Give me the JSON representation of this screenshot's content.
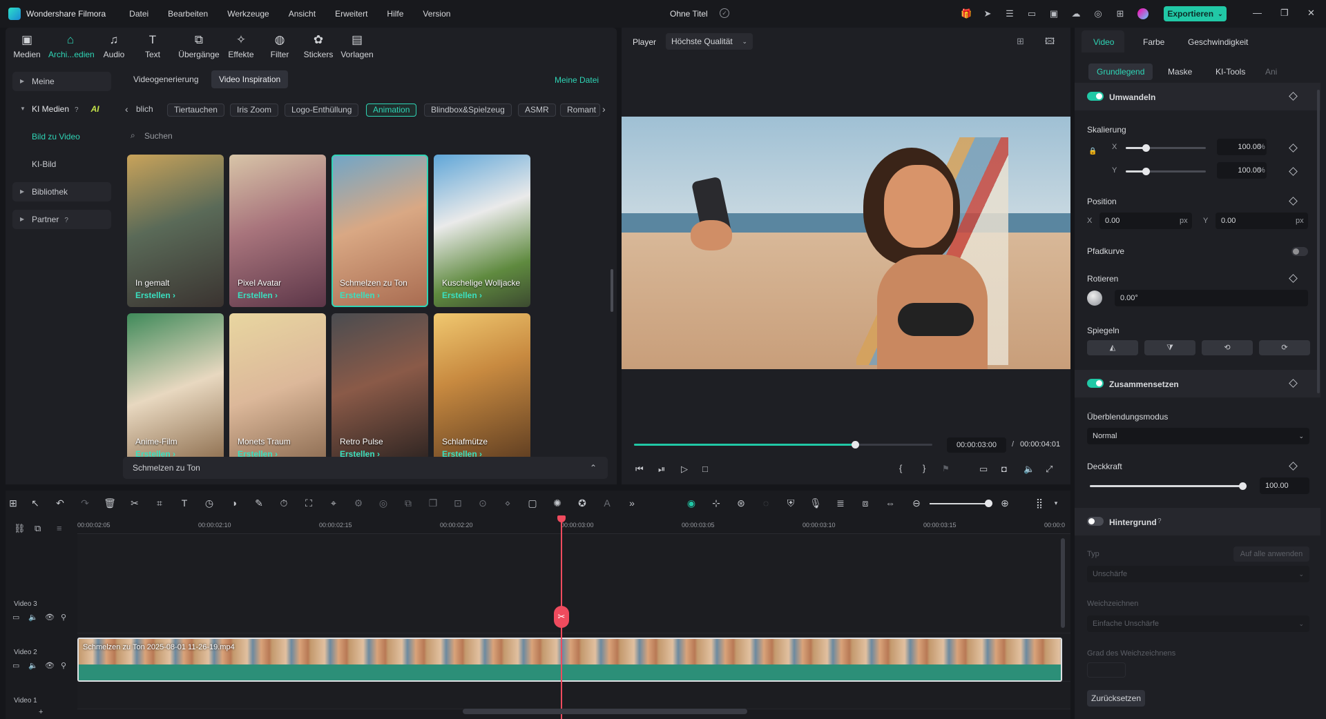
{
  "titlebar": {
    "app_name": "Wondershare Filmora",
    "menu": [
      "Datei",
      "Bearbeiten",
      "Werkzeuge",
      "Ansicht",
      "Erweitert",
      "Hilfe",
      "Version"
    ],
    "doc_title": "Ohne Titel",
    "export_label": "Exportieren",
    "accent": "#21c8a6"
  },
  "media_tabs": [
    {
      "label": "Medien",
      "icon": "media-icon"
    },
    {
      "label": "Archi...edien",
      "icon": "archive-icon"
    },
    {
      "label": "Audio",
      "icon": "audio-icon"
    },
    {
      "label": "Text",
      "icon": "text-icon"
    },
    {
      "label": "Übergänge",
      "icon": "transitions-icon"
    },
    {
      "label": "Effekte",
      "icon": "effects-icon"
    },
    {
      "label": "Filter",
      "icon": "filter-icon"
    },
    {
      "label": "Stickers",
      "icon": "stickers-icon"
    },
    {
      "label": "Vorlagen",
      "icon": "templates-icon"
    }
  ],
  "sidebar": {
    "meine": "Meine",
    "ki_medien": "KI Medien",
    "ai_badge": "AI",
    "bild_zu_video": "Bild zu Video",
    "ki_bild": "KI-Bild",
    "bibliothek": "Bibliothek",
    "partner": "Partner"
  },
  "content": {
    "tab_generation": "Videogenerierung",
    "tab_inspiration": "Video Inspiration",
    "my_file": "Meine Datei",
    "chips": [
      "blich",
      "Tiertauchen",
      "Iris Zoom",
      "Logo-Enthüllung",
      "Animation",
      "Blindbox&Spielzeug",
      "ASMR",
      "Romant"
    ],
    "search_placeholder": "Suchen",
    "cta": "Erstellen ›",
    "cards": [
      {
        "label": "In gemalt"
      },
      {
        "label": "Pixel Avatar"
      },
      {
        "label": "Schmelzen zu Ton"
      },
      {
        "label": "Kuschelige Wolljacke"
      },
      {
        "label": "Anime-Film"
      },
      {
        "label": "Monets Traum"
      },
      {
        "label": "Retro Pulse"
      },
      {
        "label": "Schlafmütze"
      }
    ],
    "bottom_label": "Schmelzen zu Ton"
  },
  "player": {
    "label": "Player",
    "quality": "Höchste Qualität",
    "current_time": "00:00:03:00",
    "separator": "/",
    "total_time": "00:00:04:01",
    "progress_fraction": 0.74
  },
  "props": {
    "tabs": [
      "Video",
      "Farbe",
      "Geschwindigkeit"
    ],
    "subtabs": [
      "Grundlegend",
      "Maske",
      "KI-Tools",
      "Ani"
    ],
    "umwandeln": "Umwandeln",
    "skalierung": "Skalierung",
    "x": "X",
    "y": "Y",
    "scale_x": "100.00",
    "scale_y": "100.00",
    "percent": "%",
    "position": "Position",
    "pos_x": "0.00",
    "pos_y": "0.00",
    "px": "px",
    "pfadkurve": "Pfadkurve",
    "rotieren": "Rotieren",
    "rotation": "0.00°",
    "spiegeln": "Spiegeln",
    "zusammensetzen": "Zusammensetzen",
    "blend_label": "Überblendungsmodus",
    "blend_value": "Normal",
    "deckkraft": "Deckkraft",
    "opacity": "100.00",
    "hintergrund": "Hintergrund",
    "typ": "Typ",
    "apply_all": "Auf alle anwenden",
    "typ_value": "Unschärfe",
    "weichzeichnen": "Weichzeichnen",
    "weich_value": "Einfache Unschärfe",
    "grad": "Grad des Weichzeichnens",
    "reset": "Zurücksetzen"
  },
  "timeline": {
    "ticks": [
      "00:00:02:05",
      "00:00:02:10",
      "00:00:02:15",
      "00:00:02:20",
      "00:00:03:00",
      "00:00:03:05",
      "00:00:03:10",
      "00:00:03:15",
      "00:00:0"
    ],
    "tracks": [
      "Video 3",
      "Video 2",
      "Video 1"
    ],
    "clip_name": "Schmelzen zu Ton 2025-08-01 11-26-19.mp4"
  }
}
